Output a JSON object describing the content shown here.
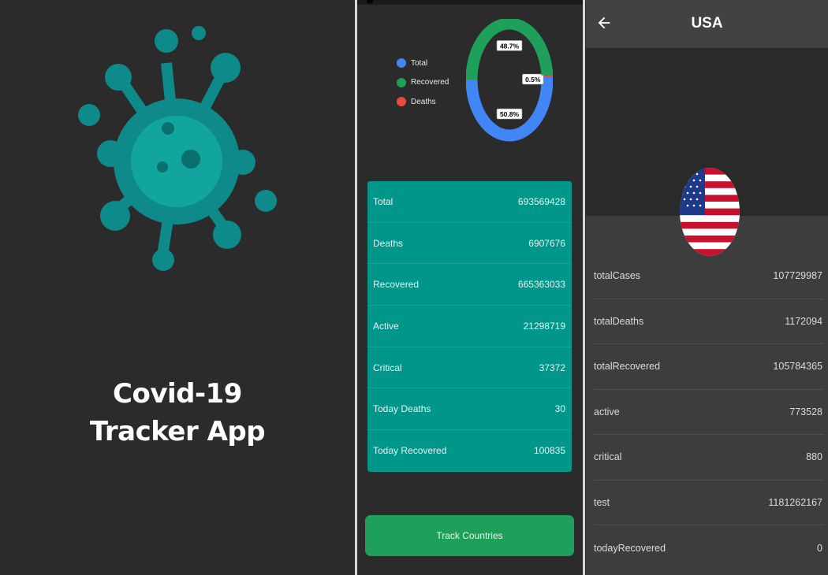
{
  "splash": {
    "title_line1": "Covid-19",
    "title_line2": "Tracker App",
    "logo_color": "#0e8a8a"
  },
  "home": {
    "legend": [
      {
        "label": "Total",
        "color": "#4285f4"
      },
      {
        "label": "Recovered",
        "color": "#1ea05a"
      },
      {
        "label": "Deaths",
        "color": "#e74c3c"
      }
    ],
    "chart_data": {
      "type": "pie",
      "categories": [
        "Total",
        "Recovered",
        "Deaths"
      ],
      "values": [
        50.8,
        48.7,
        0.5
      ],
      "labels": [
        "50.8%",
        "48.7%",
        "0.5%"
      ]
    },
    "stats": [
      {
        "label": "Total",
        "value": "693569428"
      },
      {
        "label": "Deaths",
        "value": "6907676"
      },
      {
        "label": "Recovered",
        "value": "665363033"
      },
      {
        "label": "Active",
        "value": "21298719"
      },
      {
        "label": "Critical",
        "value": "37372"
      },
      {
        "label": "Today Deaths",
        "value": "30"
      },
      {
        "label": "Today Recovered",
        "value": "100835"
      }
    ],
    "track_button": "Track Countries"
  },
  "detail": {
    "title": "USA",
    "back_icon": "arrow-left-icon",
    "flag_icon": "usa-flag-icon",
    "rows": [
      {
        "label": "totalCases",
        "value": "107729987"
      },
      {
        "label": "totalDeaths",
        "value": "1172094"
      },
      {
        "label": "totalRecovered",
        "value": "105784365"
      },
      {
        "label": "active",
        "value": "773528"
      },
      {
        "label": "critical",
        "value": "880"
      },
      {
        "label": "test",
        "value": "1181262167"
      },
      {
        "label": "todayRecovered",
        "value": "0"
      }
    ]
  }
}
